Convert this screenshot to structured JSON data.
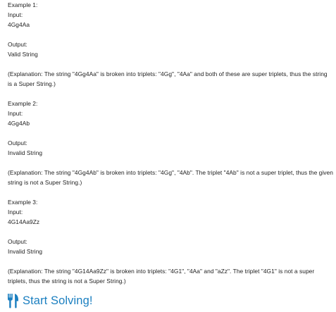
{
  "examples": [
    {
      "heading": "Example 1:",
      "input_label": "Input:",
      "input_value": "4Gg4Aa",
      "output_label": "Output:",
      "output_value": "Valid String",
      "explanation": "(Explanation: The string \"4Gg4Aa\" is broken into triplets: \"4Gg\", \"4Aa\" and both of these are super triplets, thus the string is a Super String.)"
    },
    {
      "heading": "Example 2:",
      "input_label": "Input:",
      "input_value": "4Gg4Ab",
      "output_label": "Output:",
      "output_value": "Invalid String",
      "explanation": "(Explanation: The string \"4Gg4Ab\" is broken into triplets: \"4Gg\", \"4Ab\". The triplet \"4Ab\" is not a super triplet, thus the given string is not a Super String.)"
    },
    {
      "heading": "Example 3:",
      "input_label": "Input:",
      "input_value": "4G14Aa9Zz",
      "output_label": "Output:",
      "output_value": "Invalid String",
      "explanation": "(Explanation: The string \"4G14Aa9Zz\" is broken into triplets: \"4G1\", \"4Aa\" and \"aZz\". The triplet \"4G1\" is not a super triplets, thus the string is not a Super String.)"
    }
  ],
  "cta": {
    "label": "Start Solving!",
    "icon": "fork-knife-icon",
    "color": "#1b7fc0"
  }
}
